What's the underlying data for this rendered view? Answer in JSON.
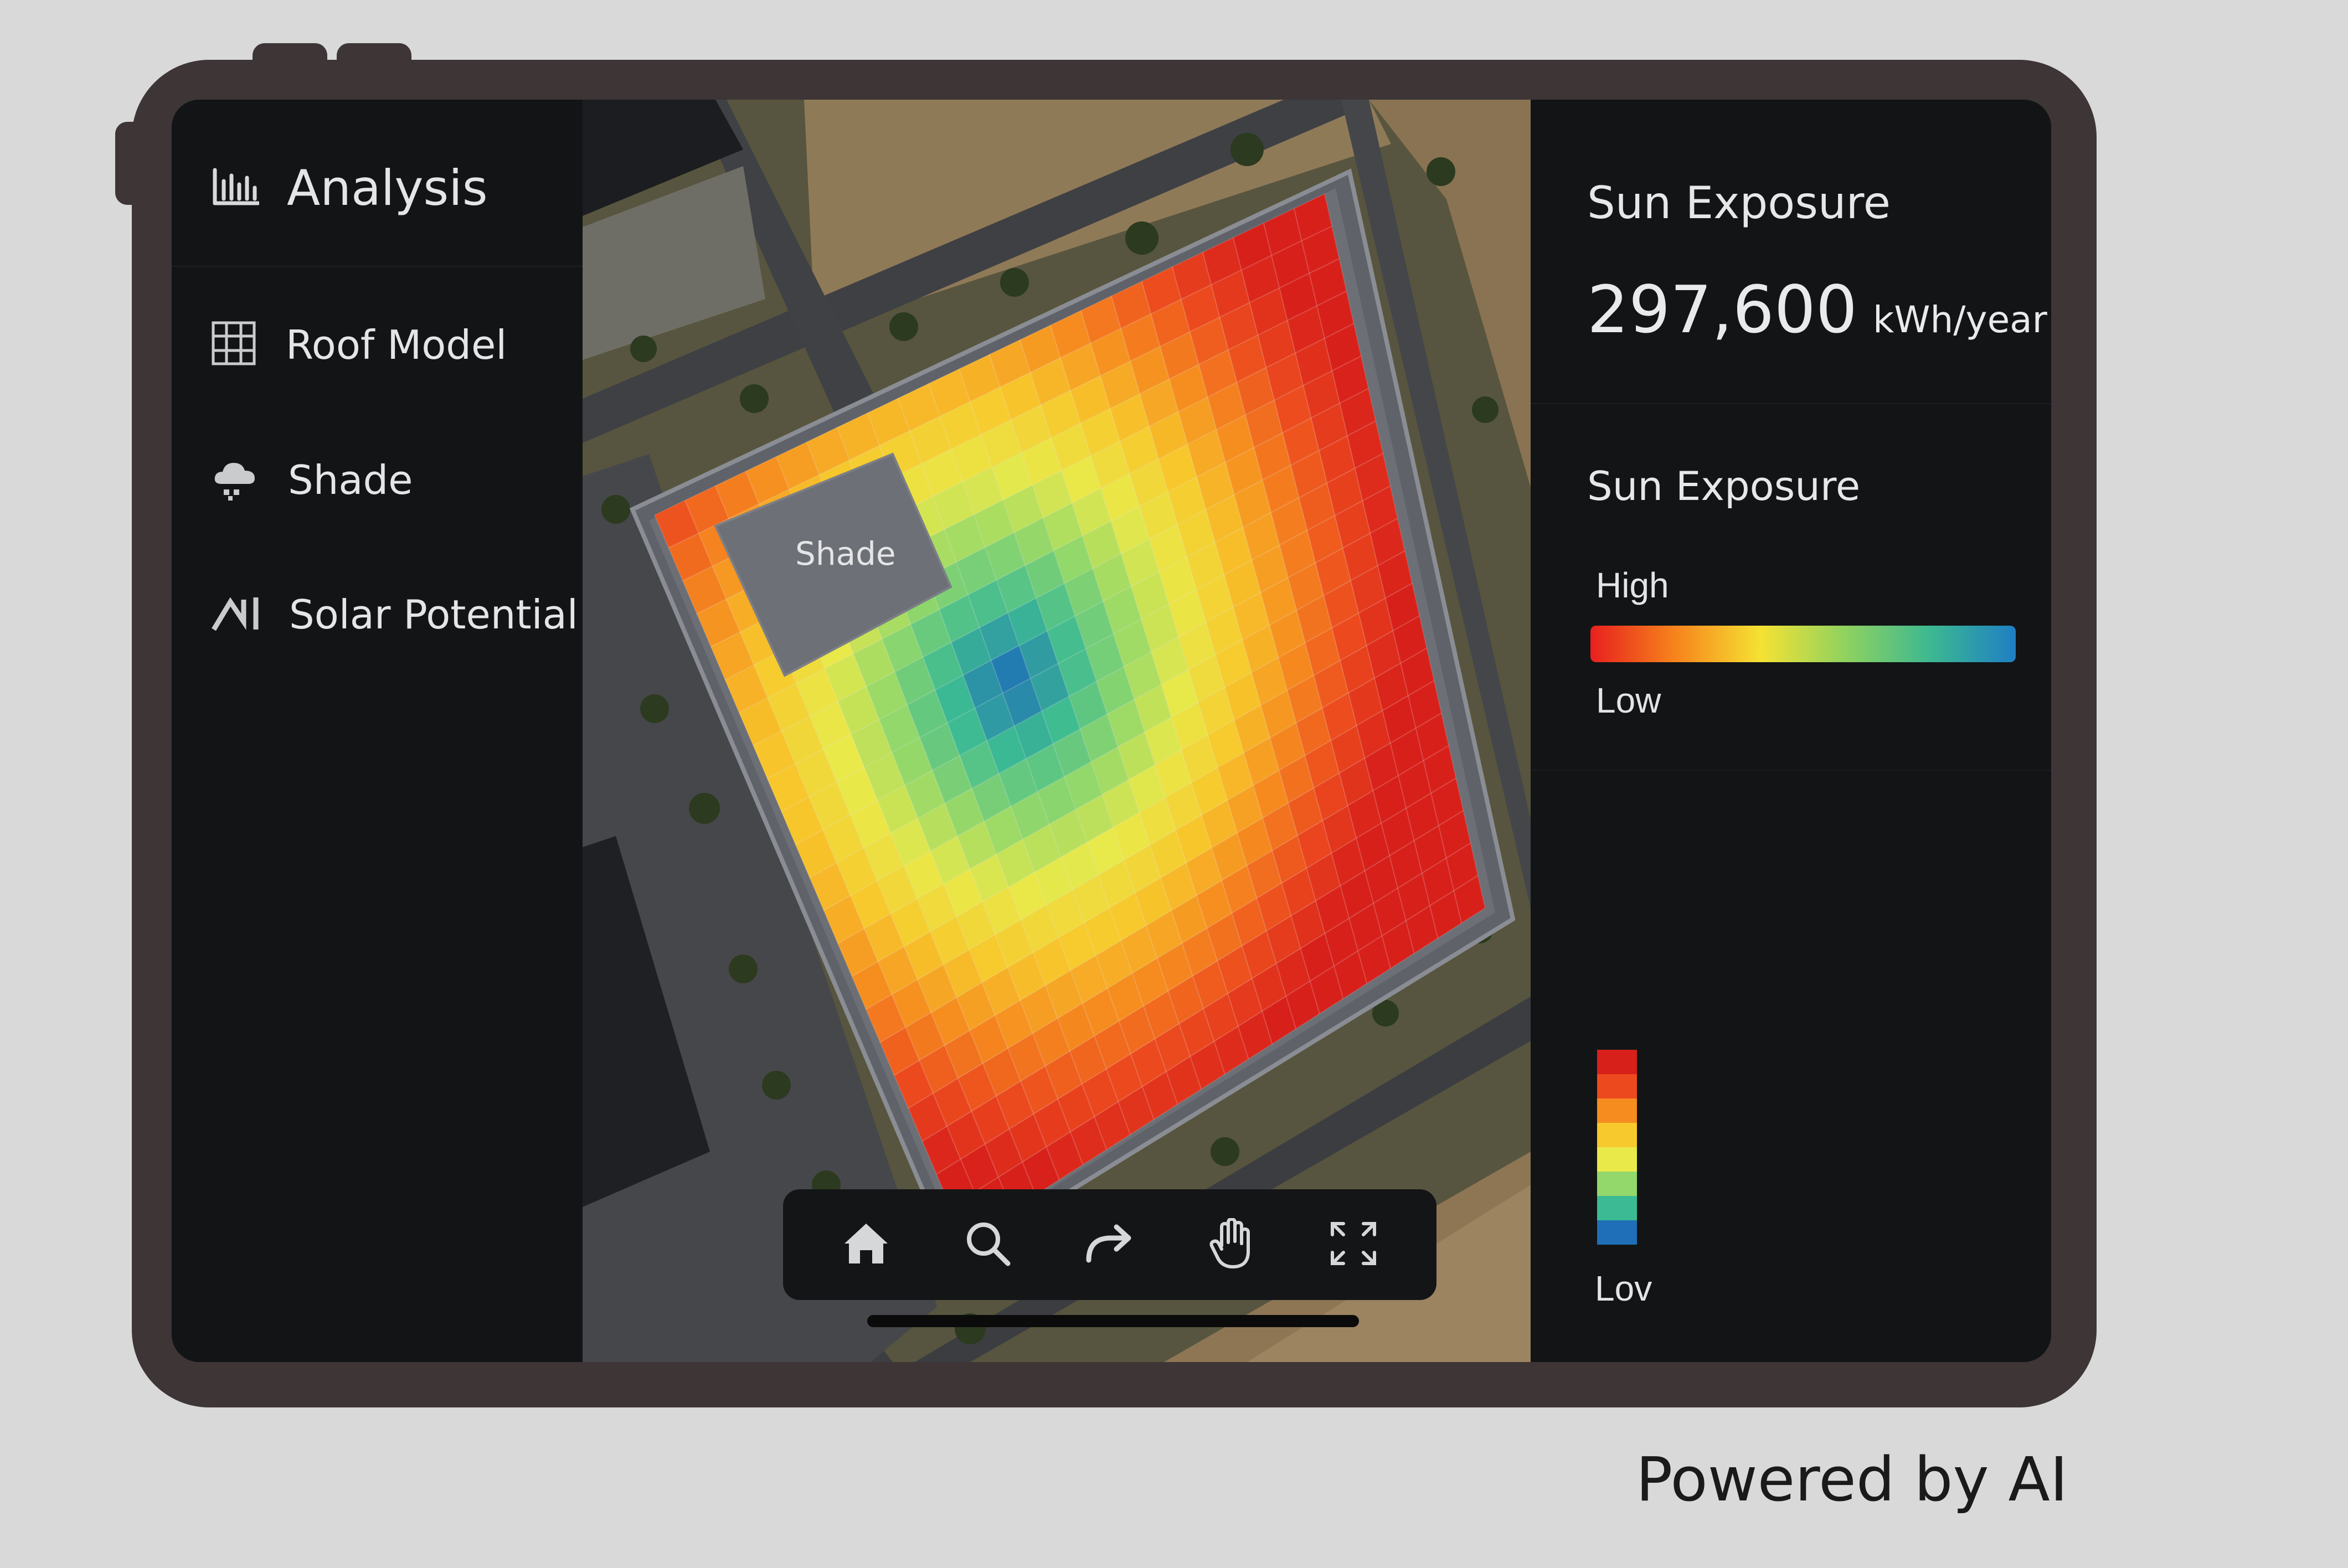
{
  "sidebar": {
    "header": {
      "icon": "bar-chart-icon",
      "title": "Analysis"
    },
    "items": [
      {
        "icon": "grid-icon",
        "label": "Roof Model"
      },
      {
        "icon": "cloud-icon",
        "label": "Shade"
      },
      {
        "icon": "trend-icon",
        "label": "Solar Potential"
      }
    ]
  },
  "map": {
    "shade_label": "Shade",
    "toolbar": [
      {
        "icon": "home-icon"
      },
      {
        "icon": "search-icon"
      },
      {
        "icon": "redo-icon"
      },
      {
        "icon": "hand-icon"
      },
      {
        "icon": "fullscreen-icon"
      }
    ]
  },
  "panel": {
    "title": "Sun Exposure",
    "value": "297,600",
    "unit": "kWh/year",
    "legend_title": "Sun Exposure",
    "high_label": "High",
    "low_label": "Low",
    "low_label_2": "Lov",
    "gradient_colors": [
      "#e8201e",
      "#f6841c",
      "#f5e233",
      "#8fd25f",
      "#3cb891",
      "#1f7fc4"
    ],
    "legend_steps": [
      "#d8201b",
      "#ec4a1e",
      "#f68c1f",
      "#f7c92c",
      "#e9e94a",
      "#93d86a",
      "#3cba93",
      "#1e6fb7"
    ]
  },
  "footer": {
    "powered_by": "Powered by AI"
  },
  "colors": {
    "frame": "#3d3536",
    "screen": "#121416",
    "background": "#d9d9da"
  }
}
